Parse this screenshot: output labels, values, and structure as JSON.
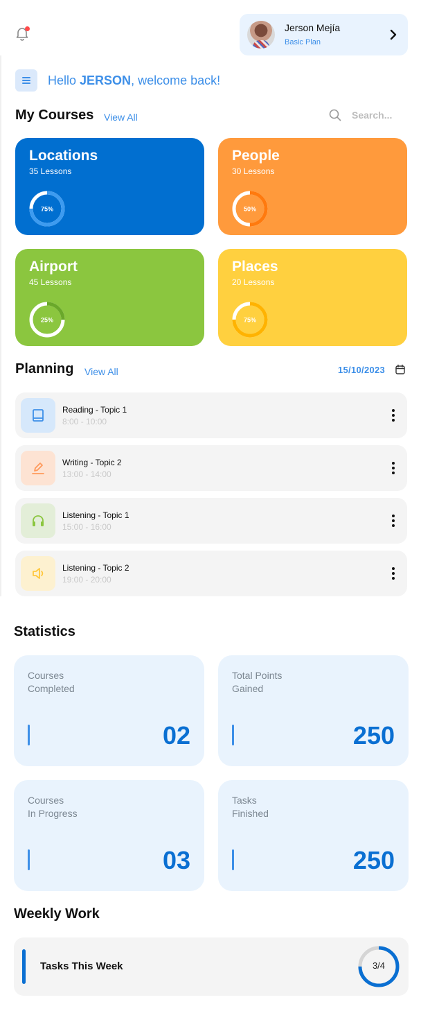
{
  "header": {
    "bell_icon": "bell-icon",
    "profile": {
      "name": "Jerson Mejía",
      "plan": "Basic Plan"
    }
  },
  "greeting": {
    "prefix": "Hello ",
    "name": "JERSON",
    "suffix": ", welcome back!"
  },
  "courses": {
    "title": "My Courses",
    "view_all": "View All",
    "search_placeholder": "Search...",
    "items": [
      {
        "title": "Locations",
        "lessons": "35 Lessons",
        "progress_label": "75%",
        "progress": 0.75,
        "color": "#016fd0",
        "ring_color": "#3d9bf0"
      },
      {
        "title": "People",
        "lessons": "30 Lessons",
        "progress_label": "50%",
        "progress": 0.5,
        "color": "#ff9a3c",
        "ring_color": "#ff7a0e"
      },
      {
        "title": "Airport",
        "lessons": "45 Lessons",
        "progress_label": "25%",
        "progress": 0.25,
        "color": "#8bc63f",
        "ring_color": "#6aa82a"
      },
      {
        "title": "Places",
        "lessons": "20 Lessons",
        "progress_label": "75%",
        "progress": 0.75,
        "color": "#ffd03f",
        "ring_color": "#ffb300"
      }
    ]
  },
  "planning": {
    "title": "Planning",
    "view_all": "View All",
    "date": "15/10/2023",
    "items": [
      {
        "title": "Reading - Topic 1",
        "time": "8:00 - 10:00",
        "icon": "book-icon",
        "bg": "#d6e8fb",
        "fg": "#3d8fe8"
      },
      {
        "title": "Writing - Topic 2",
        "time": "13:00 - 14:00",
        "icon": "pencil-icon",
        "bg": "#fde3d3",
        "fg": "#ff9a5c"
      },
      {
        "title": "Listening - Topic 1",
        "time": "15:00 - 16:00",
        "icon": "headphones-icon",
        "bg": "#e3eed8",
        "fg": "#8bc63f"
      },
      {
        "title": "Listening - Topic 2",
        "time": "19:00 - 20:00",
        "icon": "speaker-icon",
        "bg": "#fdf1d0",
        "fg": "#ffc83f"
      }
    ]
  },
  "statistics": {
    "title": "Statistics",
    "cards": [
      {
        "label_line1": "Courses",
        "label_line2": "Completed",
        "value": "02"
      },
      {
        "label_line1": "Total Points",
        "label_line2": "Gained",
        "value": "250"
      },
      {
        "label_line1": "Courses",
        "label_line2": "In Progress",
        "value": "03"
      },
      {
        "label_line1": "Tasks",
        "label_line2": "Finished",
        "value": "250"
      }
    ]
  },
  "weekly": {
    "title": "Weekly Work",
    "label": "Tasks This Week",
    "count": "3/4",
    "progress": 0.75
  }
}
